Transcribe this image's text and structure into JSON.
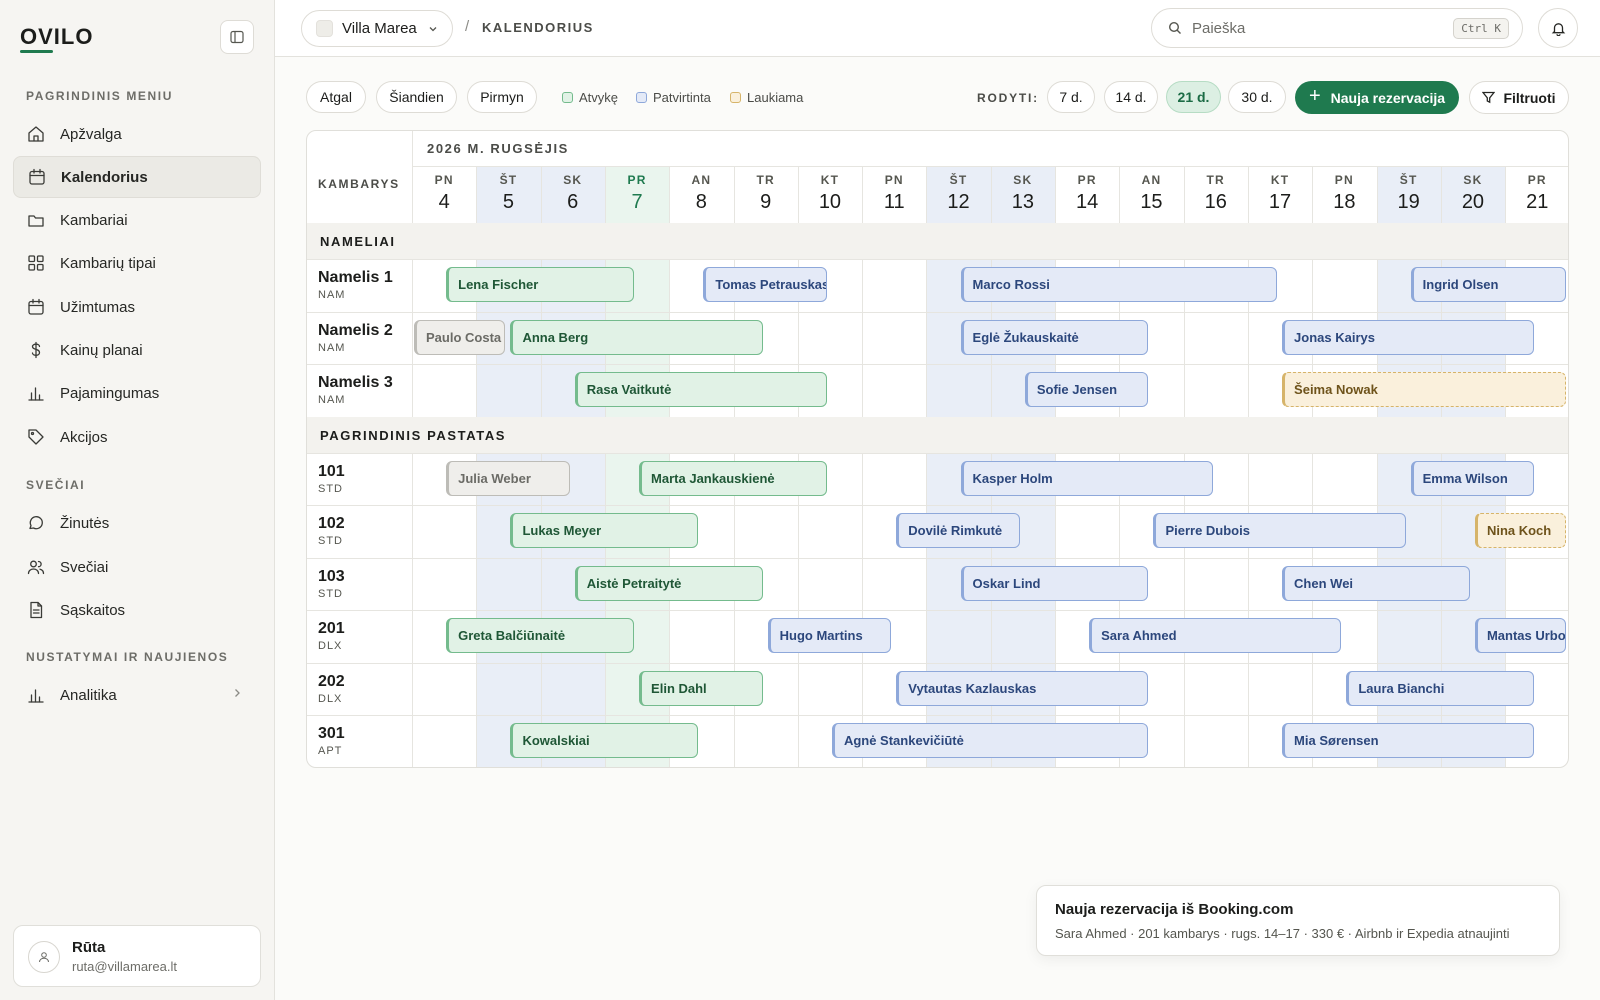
{
  "app": {
    "logo": "OVILO"
  },
  "sidebar": {
    "main_label": "PAGRINDINIS MENIU",
    "main_items": [
      {
        "label": "Apžvalga",
        "icon": "home-icon"
      },
      {
        "label": "Kalendorius",
        "icon": "calendar-icon",
        "active": true
      },
      {
        "label": "Kambariai",
        "icon": "folder-icon"
      },
      {
        "label": "Kambarių tipai",
        "icon": "grid-icon"
      },
      {
        "label": "Užimtumas",
        "icon": "calendar-icon"
      },
      {
        "label": "Kainų planai",
        "icon": "dollar-icon"
      },
      {
        "label": "Pajamingumas",
        "icon": "bar-chart-icon"
      },
      {
        "label": "Akcijos",
        "icon": "tag-icon"
      }
    ],
    "guests_label": "SVEČIAI",
    "guest_items": [
      {
        "label": "Žinutės",
        "icon": "message-icon"
      },
      {
        "label": "Svečiai",
        "icon": "users-icon"
      },
      {
        "label": "Sąskaitos",
        "icon": "file-icon"
      }
    ],
    "settings_label": "NUSTATYMAI IR NAUJIENOS",
    "settings_items": [
      {
        "label": "Analitika",
        "icon": "bar-chart-icon"
      }
    ],
    "user": {
      "name": "Rūta",
      "email": "ruta@villamarea.lt"
    }
  },
  "topbar": {
    "property": "Villa Marea",
    "separator": "/",
    "breadcrumb": "KALENDORIUS",
    "search_placeholder": "Paieška",
    "search_shortcut": "Ctrl K"
  },
  "toolbar": {
    "back": "Atgal",
    "today": "Šiandien",
    "forward": "Pirmyn",
    "legend": [
      {
        "label": "Atvykę",
        "color": "#74bb8d"
      },
      {
        "label": "Patvirtinta",
        "color": "#8ea8da"
      },
      {
        "label": "Laukiama",
        "color": "#d6b46a"
      }
    ],
    "show_label": "RODYTI:",
    "ranges": [
      "7 d.",
      "14 d.",
      "21 d.",
      "30 d."
    ],
    "active_range": "21 d.",
    "new_booking": "Nauja rezervacija",
    "filter": "Filtruoti"
  },
  "calendar": {
    "month": "2026 M. RUGSĖJIS",
    "rooms_header": "KAMBARYS",
    "days": [
      {
        "wd": "PN",
        "d": "4"
      },
      {
        "wd": "ŠT",
        "d": "5",
        "weekend": true
      },
      {
        "wd": "SK",
        "d": "6",
        "weekend": true
      },
      {
        "wd": "PR",
        "d": "7",
        "today": true
      },
      {
        "wd": "AN",
        "d": "8"
      },
      {
        "wd": "TR",
        "d": "9"
      },
      {
        "wd": "KT",
        "d": "10"
      },
      {
        "wd": "PN",
        "d": "11"
      },
      {
        "wd": "ŠT",
        "d": "12",
        "weekend": true
      },
      {
        "wd": "SK",
        "d": "13",
        "weekend": true
      },
      {
        "wd": "PR",
        "d": "14"
      },
      {
        "wd": "AN",
        "d": "15"
      },
      {
        "wd": "TR",
        "d": "16"
      },
      {
        "wd": "KT",
        "d": "17"
      },
      {
        "wd": "PN",
        "d": "18"
      },
      {
        "wd": "ŠT",
        "d": "19",
        "weekend": true
      },
      {
        "wd": "SK",
        "d": "20",
        "weekend": true
      },
      {
        "wd": "PR",
        "d": "21"
      }
    ],
    "groups": [
      {
        "label": "NAMELIAI",
        "rooms": [
          {
            "name": "Namelis 1",
            "type": "NAM",
            "bookings": [
              {
                "guest": "Lena Fischer",
                "start": 0.5,
                "end": 3.5,
                "status": "checkedin"
              },
              {
                "guest": "Tomas Petrauskas",
                "start": 4.5,
                "end": 6.5,
                "status": "confirmed"
              },
              {
                "guest": "Marco Rossi",
                "start": 8.5,
                "end": 13.5,
                "status": "confirmed"
              },
              {
                "guest": "Ingrid Olsen",
                "start": 15.5,
                "end": 18,
                "status": "confirmed"
              }
            ]
          },
          {
            "name": "Namelis 2",
            "type": "NAM",
            "bookings": [
              {
                "guest": "Paulo Costa",
                "start": 0,
                "end": 1.5,
                "status": "past"
              },
              {
                "guest": "Anna Berg",
                "start": 1.5,
                "end": 5.5,
                "status": "checkedin"
              },
              {
                "guest": "Eglė Žukauskaitė",
                "start": 8.5,
                "end": 11.5,
                "status": "confirmed"
              },
              {
                "guest": "Jonas Kairys",
                "start": 13.5,
                "end": 17.5,
                "status": "confirmed"
              }
            ]
          },
          {
            "name": "Namelis 3",
            "type": "NAM",
            "bookings": [
              {
                "guest": "Rasa Vaitkutė",
                "start": 2.5,
                "end": 6.5,
                "status": "checkedin"
              },
              {
                "guest": "Sofie Jensen",
                "start": 9.5,
                "end": 11.5,
                "status": "confirmed"
              },
              {
                "guest": "Šeima Nowak",
                "start": 13.5,
                "end": 18,
                "status": "pending"
              }
            ]
          }
        ]
      },
      {
        "label": "PAGRINDINIS PASTATAS",
        "rooms": [
          {
            "name": "101",
            "type": "STD",
            "bookings": [
              {
                "guest": "Julia Weber",
                "start": 0.5,
                "end": 2.5,
                "status": "past"
              },
              {
                "guest": "Marta Jankauskienė",
                "start": 3.5,
                "end": 6.5,
                "status": "checkedin"
              },
              {
                "guest": "Kasper Holm",
                "start": 8.5,
                "end": 12.5,
                "status": "confirmed"
              },
              {
                "guest": "Emma Wilson",
                "start": 15.5,
                "end": 17.5,
                "status": "confirmed"
              }
            ]
          },
          {
            "name": "102",
            "type": "STD",
            "bookings": [
              {
                "guest": "Lukas Meyer",
                "start": 1.5,
                "end": 4.5,
                "status": "checkedin"
              },
              {
                "guest": "Dovilė Rimkutė",
                "start": 7.5,
                "end": 9.5,
                "status": "confirmed"
              },
              {
                "guest": "Pierre Dubois",
                "start": 11.5,
                "end": 15.5,
                "status": "confirmed"
              },
              {
                "guest": "Nina Koch",
                "start": 16.5,
                "end": 18,
                "status": "pending"
              }
            ]
          },
          {
            "name": "103",
            "type": "STD",
            "bookings": [
              {
                "guest": "Aistė Petraitytė",
                "start": 2.5,
                "end": 5.5,
                "status": "checkedin"
              },
              {
                "guest": "Oskar Lind",
                "start": 8.5,
                "end": 11.5,
                "status": "confirmed"
              },
              {
                "guest": "Chen Wei",
                "start": 13.5,
                "end": 16.5,
                "status": "confirmed"
              }
            ]
          },
          {
            "name": "201",
            "type": "DLX",
            "bookings": [
              {
                "guest": "Greta Balčiūnaitė",
                "start": 0.5,
                "end": 3.5,
                "status": "checkedin"
              },
              {
                "guest": "Hugo Martins",
                "start": 5.5,
                "end": 7.5,
                "status": "confirmed"
              },
              {
                "guest": "Sara Ahmed",
                "start": 10.5,
                "end": 14.5,
                "status": "confirmed"
              },
              {
                "guest": "Mantas Urbonas",
                "start": 16.5,
                "end": 18,
                "status": "confirmed"
              }
            ]
          },
          {
            "name": "202",
            "type": "DLX",
            "bookings": [
              {
                "guest": "Elin Dahl",
                "start": 3.5,
                "end": 5.5,
                "status": "checkedin"
              },
              {
                "guest": "Vytautas Kazlauskas",
                "start": 7.5,
                "end": 11.5,
                "status": "confirmed"
              },
              {
                "guest": "Laura Bianchi",
                "start": 14.5,
                "end": 17.5,
                "status": "confirmed"
              }
            ]
          },
          {
            "name": "301",
            "type": "APT",
            "bookings": [
              {
                "guest": "Kowalskiai",
                "start": 1.5,
                "end": 4.5,
                "status": "checkedin"
              },
              {
                "guest": "Agnė Stankevičiūtė",
                "start": 6.5,
                "end": 11.5,
                "status": "confirmed"
              },
              {
                "guest": "Mia Sørensen",
                "start": 13.5,
                "end": 17.5,
                "status": "confirmed"
              }
            ]
          }
        ]
      }
    ]
  },
  "toast": {
    "title": "Nauja rezervacija iš Booking.com",
    "body": "Sara Ahmed · 201 kambarys · rugs. 14–17 · 330 € · Airbnb ir Expedia atnaujinti"
  }
}
